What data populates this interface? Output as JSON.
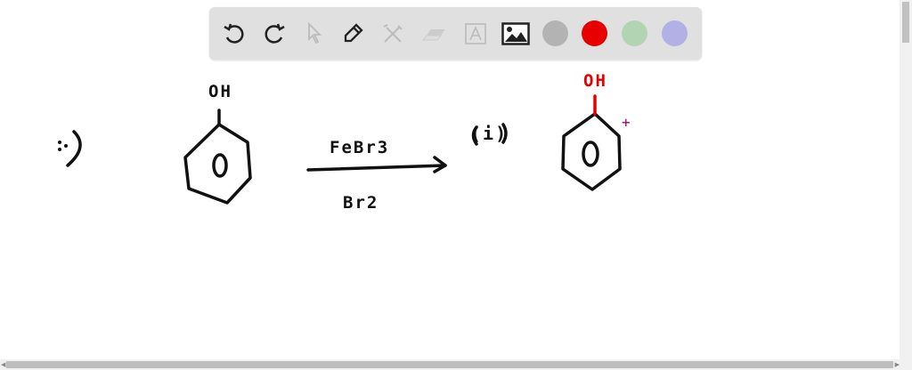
{
  "toolbar": {
    "tools": [
      "undo-icon",
      "redo-icon",
      "select-icon",
      "pen-icon",
      "tools-icon",
      "eraser-icon",
      "text-icon",
      "image-icon"
    ],
    "colors": [
      "#b3b3b3",
      "#e60000",
      "#b3d4b3",
      "#b3b0e6"
    ]
  },
  "canvas": {
    "question_label": "i)",
    "reactant_group": "OH",
    "reagent_top": "FeBr3",
    "reagent_bottom": "Br2",
    "step_label": "(i)",
    "product_group": "OH",
    "plus_sign": "+"
  }
}
